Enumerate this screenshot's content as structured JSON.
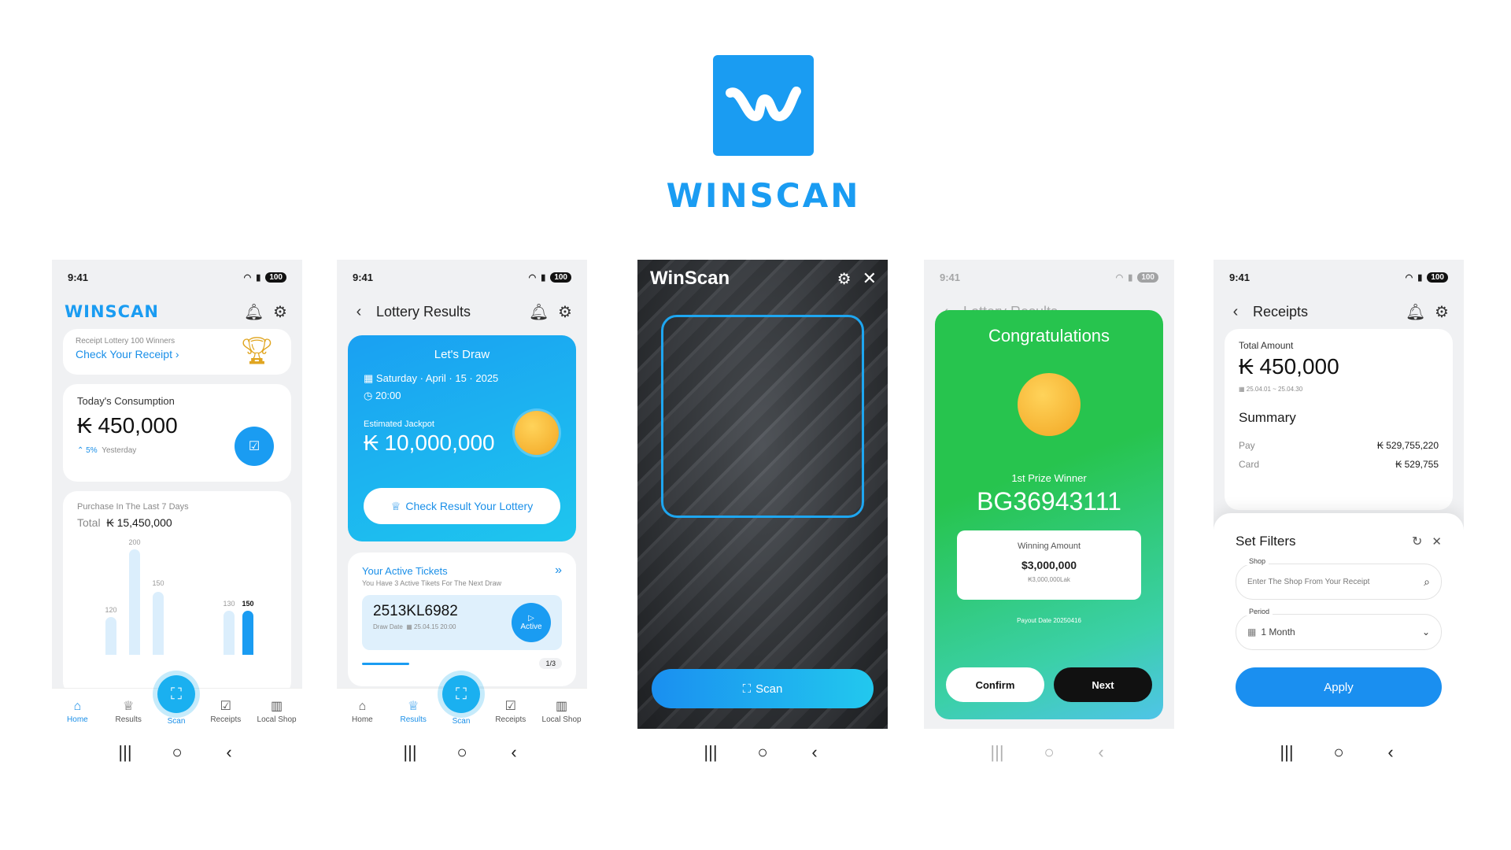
{
  "brand": {
    "wordmark": "WINSCAN"
  },
  "status": {
    "time": "9:41",
    "battery": "100"
  },
  "home": {
    "brand_label": "WINSCAN",
    "lottery_promo": {
      "caption": "Receipt Lottery",
      "winners": "100 Winners",
      "link": "Check Your Receipt"
    },
    "today": {
      "label": "Today's Consumption",
      "amount": "₭ 450,000",
      "change": "5%",
      "compare": "Yesterday"
    },
    "last7": {
      "label": "Purchase In The Last 7 Days",
      "total_label": "Total",
      "total": "₭ 15,450,000",
      "bar_labels": [
        "120",
        "200",
        "150",
        "130",
        "150"
      ]
    }
  },
  "tabs": {
    "home": "Home",
    "results": "Results",
    "scan": "Scan",
    "receipts": "Receipts",
    "local_shop": "Local Shop"
  },
  "results": {
    "title": "Lottery Results",
    "draw": {
      "heading": "Let's Draw",
      "date": "Saturday · April · 15 · 2025",
      "time": "20:00",
      "jackpot_label": "Estimated Jackpot",
      "jackpot": "₭ 10,000,000",
      "button": "Check Result Your Lottery"
    },
    "tickets": {
      "heading": "Your Active Tickets",
      "subtitle": "You Have 3 Active Tikets For The Next Draw",
      "code": "2513KL6982",
      "draw_date_label": "Draw Date",
      "draw_date": "25.04.15 20:00",
      "badge": "Active",
      "pager": "1/3"
    }
  },
  "scan": {
    "title": "WinScan",
    "button": "Scan"
  },
  "winner": {
    "heading": "Congratulations",
    "prize_label": "1st Prize Winner",
    "code": "BG36943111",
    "amount_label": "Winning Amount",
    "amount": "$3,000,000",
    "amount_sub": "₭3,000,000Lak",
    "payout": "Payout Date 20250416",
    "confirm": "Confirm",
    "next": "Next",
    "bg_title": "Lottery Results"
  },
  "receipts": {
    "title": "Receipts",
    "total_label": "Total Amount",
    "total": "₭ 450,000",
    "range": "25.04.01 ~ 25.04.30",
    "summary": "Summary",
    "rows": [
      {
        "label": "Pay",
        "value": "₭ 529,755,220"
      },
      {
        "label": "Card",
        "value": "₭ 529,755"
      }
    ],
    "filters": {
      "title": "Set Filters",
      "shop_label": "Shop",
      "shop_placeholder": "Enter The Shop From Your Receipt",
      "period_label": "Period",
      "period_value": "1 Month",
      "apply": "Apply"
    }
  },
  "colors": {
    "accent": "#1a9cf2",
    "success": "#27c44e",
    "dark": "#111111"
  }
}
